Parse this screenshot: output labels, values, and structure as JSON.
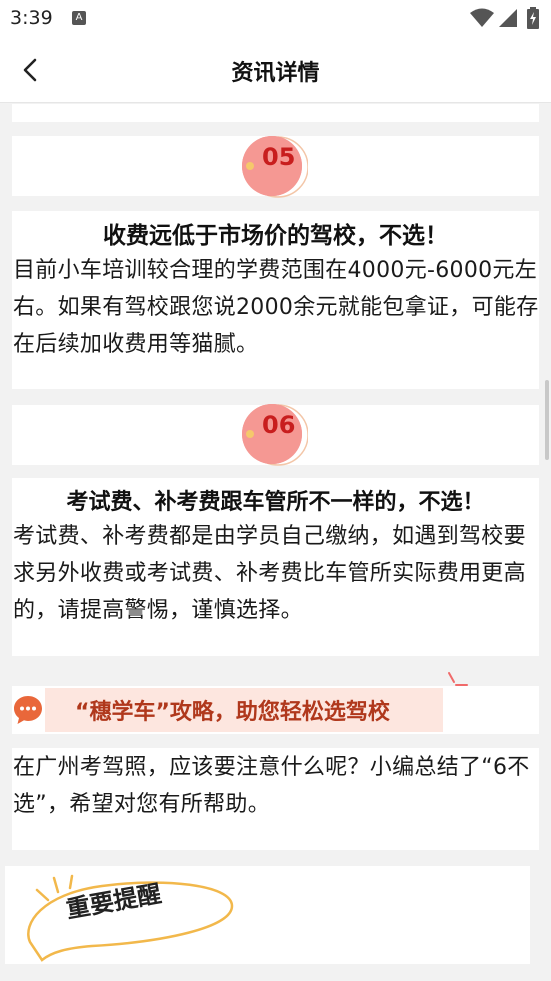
{
  "status_bar": {
    "time": "3:39",
    "notification_icon": "a-icon",
    "icons": [
      "wifi-icon",
      "signal-icon",
      "battery-charging-icon"
    ]
  },
  "header": {
    "title": "资讯详情",
    "back_icon": "chevron-left-icon"
  },
  "sections": [
    {
      "number": "05",
      "heading": "收费远低于市场价的驾校，不选！",
      "body": "目前小车培训较合理的学费范围在4000元-6000元左右。如果有驾校跟您说2000余元就能包拿证，可能存在后续加收费用等猫腻。"
    },
    {
      "number": "06",
      "heading": "考试费、补考费跟车管所不一样的，不选！",
      "body": "考试费、补考费都是由学员自己缴纳，如遇到驾校要求另外收费或考试费、补考费比车管所实际费用更高的，请提高警惕，谨慎选择。"
    }
  ],
  "promo": {
    "icon": "chat-bubble-icon",
    "text": "“穗学车”攻略，助您轻松选驾校",
    "body": "在广州考驾照，应该要注意什么呢？小编总结了“6不选”，希望对您有所帮助。"
  },
  "reminder": {
    "label": "重要提醒"
  },
  "colors": {
    "accent_red": "#c81e1e",
    "promo_band": "#fde6df",
    "promo_text": "#b0381c",
    "page_bg": "#f2f2f2"
  }
}
